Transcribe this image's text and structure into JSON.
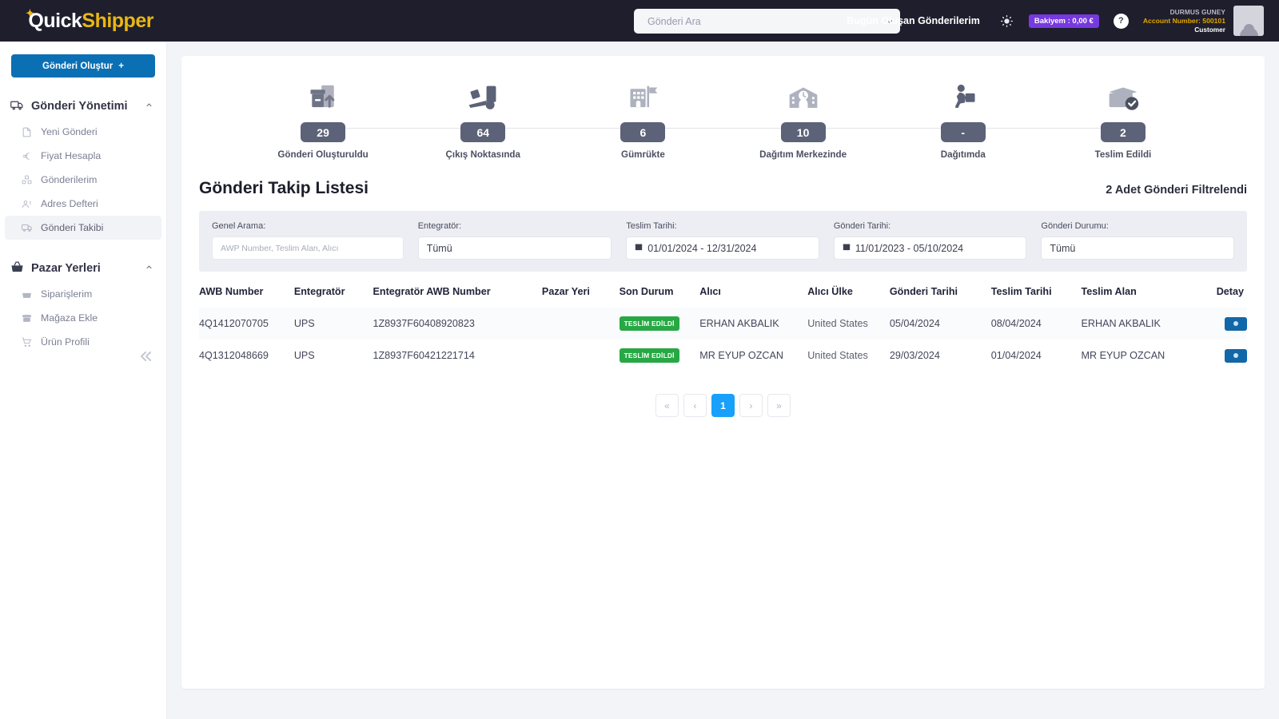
{
  "brand": {
    "mark": "✦",
    "part1": "uick",
    "part2": "Shipper",
    "leading": "Q"
  },
  "header": {
    "search_placeholder": "Gönderi Ara",
    "today_link": "Bugün Oluşan Gönderilerim",
    "balance_badge": "Bakiyem : 0,00 €",
    "help_label": "?",
    "account_name": "DURMUS GUNEY",
    "account_number": "Account Number: 500101",
    "account_role": "Customer",
    "theme_icon": "sun-icon"
  },
  "sidebar": {
    "create_button": "Gönderi Oluştur",
    "create_button_plus": "+",
    "groups": [
      {
        "title": "Gönderi Yönetimi",
        "icon": "truck-icon",
        "caret": "⌃",
        "items": [
          {
            "label": "Yeni Gönderi",
            "icon": "document-icon",
            "active": false
          },
          {
            "label": "Fiyat Hesapla",
            "icon": "euro-icon",
            "active": false
          },
          {
            "label": "Gönderilerim",
            "icon": "boxes-icon",
            "active": false
          },
          {
            "label": "Adres Defteri",
            "icon": "contacts-icon",
            "active": false
          },
          {
            "label": "Gönderi Takibi",
            "icon": "truck-icon",
            "active": true
          }
        ]
      },
      {
        "title": "Pazar Yerleri",
        "icon": "basket-icon",
        "caret": "⌃",
        "items": [
          {
            "label": "Siparişlerim",
            "icon": "basket-icon",
            "active": false
          },
          {
            "label": "Mağaza Ekle",
            "icon": "store-icon",
            "active": false
          },
          {
            "label": "Ürün Profili",
            "icon": "cart-icon",
            "active": false
          }
        ]
      }
    ],
    "collapse_icon": "«"
  },
  "stepper": [
    {
      "count": "29",
      "label": "Gönderi Oluşturuldu",
      "icon": "package-upload-icon"
    },
    {
      "count": "64",
      "label": "Çıkış Noktasında",
      "icon": "forklift-icon"
    },
    {
      "count": "6",
      "label": "Gümrükte",
      "icon": "customs-building-icon"
    },
    {
      "count": "10",
      "label": "Dağıtım Merkezinde",
      "icon": "distribution-center-icon"
    },
    {
      "count": "-",
      "label": "Dağıtımda",
      "icon": "courier-icon"
    },
    {
      "count": "2",
      "label": "Teslim Edildi",
      "icon": "package-check-icon"
    }
  ],
  "main": {
    "page_title": "Gönderi Takip Listesi",
    "filtered_count": "2 Adet Gönderi Filtrelendi"
  },
  "filters": [
    {
      "label": "Genel Arama:",
      "value": "",
      "placeholder": "AWP Number, Teslim Alan, Alıcı",
      "kind": "text"
    },
    {
      "label": "Entegratör:",
      "value": "Tümü",
      "kind": "select"
    },
    {
      "label": "Teslim Tarihi:",
      "value": "01/01/2024 - 12/31/2024",
      "kind": "date"
    },
    {
      "label": "Gönderi Tarihi:",
      "value": "11/01/2023 - 05/10/2024",
      "kind": "date"
    },
    {
      "label": "Gönderi Durumu:",
      "value": "Tümü",
      "kind": "select"
    }
  ],
  "table": {
    "columns": [
      "AWB Number",
      "Entegratör",
      "Entegratör AWB Number",
      "Pazar Yeri",
      "Son Durum",
      "Alıcı",
      "Alıcı Ülke",
      "Gönderi Tarihi",
      "Teslim Tarihi",
      "Teslim Alan",
      "Detay"
    ],
    "rows": [
      {
        "awb": "4Q1412070705",
        "integrator": "UPS",
        "integrator_awb": "1Z8937F60408920823",
        "marketplace": "",
        "status": "TESLİM EDİLDİ",
        "receiver": "ERHAN AKBALIK",
        "country": "United States",
        "ship_date": "05/04/2024",
        "delivery_date": "08/04/2024",
        "received_by": "ERHAN AKBALIK"
      },
      {
        "awb": "4Q1312048669",
        "integrator": "UPS",
        "integrator_awb": "1Z8937F60421221714",
        "marketplace": "",
        "status": "TESLİM EDİLDİ",
        "receiver": "MR EYUP OZCAN",
        "country": "United States",
        "ship_date": "29/03/2024",
        "delivery_date": "01/04/2024",
        "received_by": "MR EYUP OZCAN"
      }
    ]
  },
  "pagination": {
    "first": "«",
    "prev": "‹",
    "current": "1",
    "next": "›",
    "last": "»"
  },
  "colors": {
    "accent_blue": "#0b6fb4",
    "page_blue": "#18a0fb",
    "status_green": "#27a844",
    "balance_purple": "#7739e0",
    "brand_yellow": "#e8b713",
    "topbar": "#1e1e2d"
  }
}
